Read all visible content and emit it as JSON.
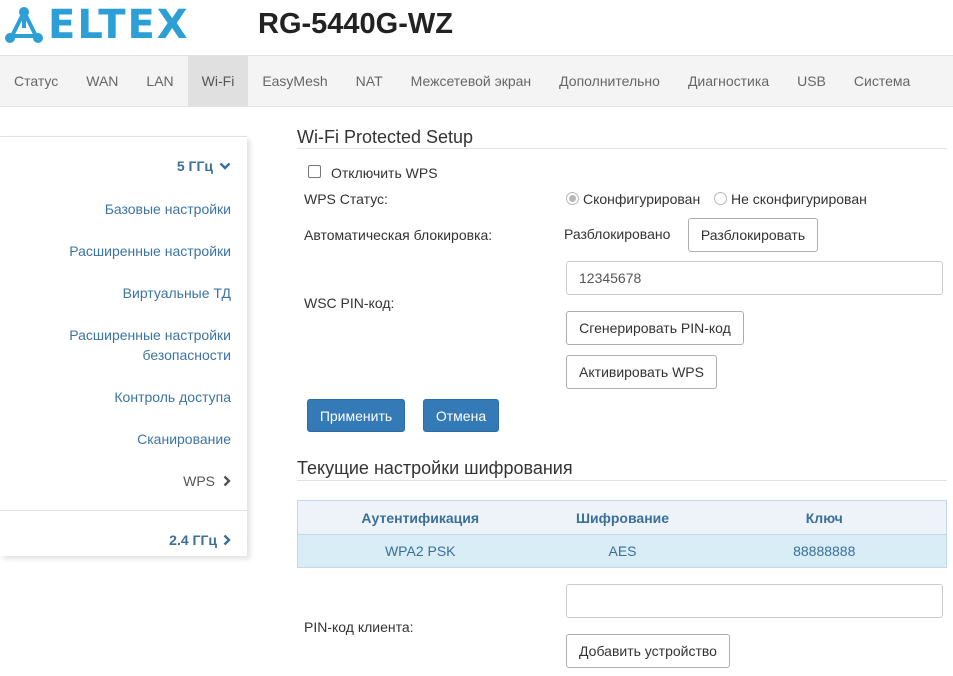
{
  "header": {
    "logo_text": "ELTEX",
    "model": "RG-5440G-WZ"
  },
  "nav": {
    "items": [
      {
        "label": "Статус"
      },
      {
        "label": "WAN"
      },
      {
        "label": "LAN"
      },
      {
        "label": "Wi-Fi",
        "active": true
      },
      {
        "label": "EasyMesh"
      },
      {
        "label": "NAT"
      },
      {
        "label": "Межсетевой экран"
      },
      {
        "label": "Дополнительно"
      },
      {
        "label": "Диагностика"
      },
      {
        "label": "USB"
      },
      {
        "label": "Система"
      }
    ]
  },
  "sidebar": {
    "group_5ghz": "5 ГГц",
    "items": [
      {
        "label": "Базовые настройки"
      },
      {
        "label": "Расширенные настройки"
      },
      {
        "label": "Виртуальные ТД"
      },
      {
        "label": "Расширенные настройки безопасности"
      },
      {
        "label": "Контроль доступа"
      },
      {
        "label": "Сканирование"
      },
      {
        "label": "WPS",
        "current": true
      }
    ],
    "group_24ghz": "2.4 ГГц"
  },
  "wps": {
    "title": "Wi-Fi Protected Setup",
    "disable_label": "Отключить WPS",
    "disable_checked": false,
    "status_label": "WPS Статус:",
    "status_configured": "Сконфигурирован",
    "status_not_configured": "Не сконфигурирован",
    "status_selected": "configured",
    "autolock_label": "Автоматическая блокировка:",
    "autolock_value": "Разблокировано",
    "unlock_button": "Разблокировать",
    "pin_label": "WSC PIN-код:",
    "pin_value": "12345678",
    "generate_pin_button": "Сгенерировать PIN-код",
    "activate_wps_button": "Активировать WPS",
    "apply_button": "Применить",
    "cancel_button": "Отмена"
  },
  "encryption": {
    "title": "Текущие настройки шифрования",
    "headers": [
      "Аутентификация",
      "Шифрование",
      "Ключ"
    ],
    "row": [
      "WPA2 PSK",
      "AES",
      "88888888"
    ]
  },
  "client": {
    "pin_label": "PIN-код клиента:",
    "pin_value": "",
    "add_device_button": "Добавить устройство"
  },
  "colors": {
    "brand": "#2c9fd6",
    "link": "#3c74a4",
    "primary_button": "#337ab7",
    "table_row": "#d9edf7"
  }
}
